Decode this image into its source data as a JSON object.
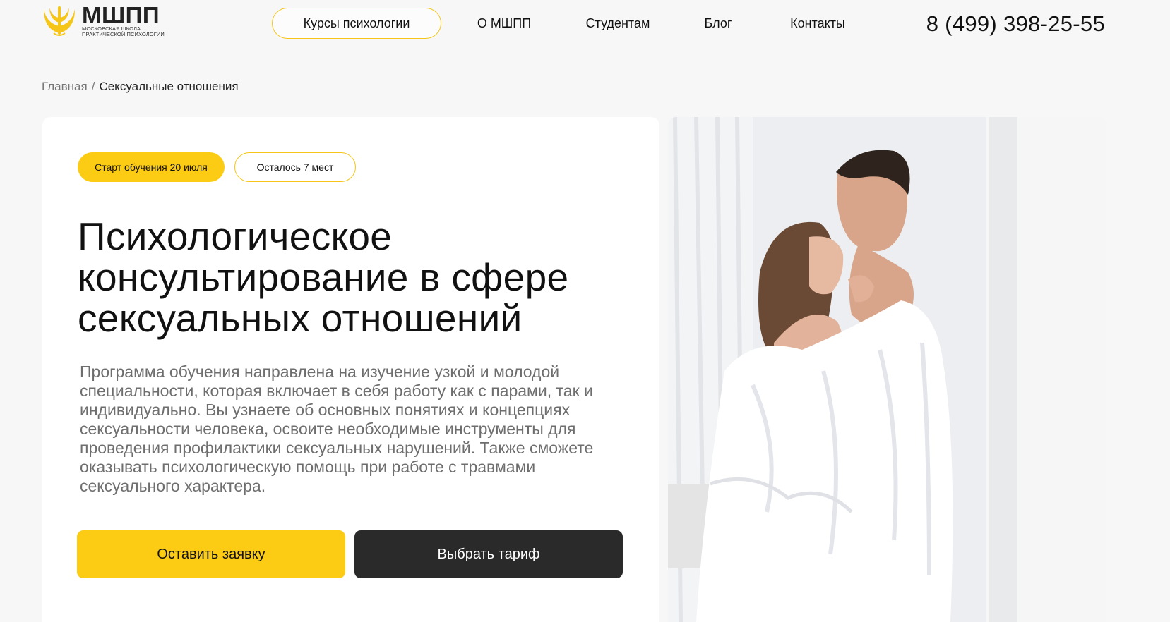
{
  "header": {
    "logo": {
      "title": "МШПП",
      "subtitle_line1": "Московская школа",
      "subtitle_line2": "практической психологии",
      "color": "#f5c518"
    },
    "nav": [
      {
        "label": "Курсы психологии"
      },
      {
        "label": "О МШПП"
      },
      {
        "label": "Студентам"
      },
      {
        "label": "Блог"
      },
      {
        "label": "Контакты"
      }
    ],
    "phone": "8 (499) 398-25-55"
  },
  "breadcrumb": {
    "home": "Главная",
    "separator": "/",
    "current": "Сексуальные отношения"
  },
  "hero": {
    "badges": {
      "start": "Старт обучения 20 июля",
      "seats": "Осталось 7 мест"
    },
    "title_line1": "Психологическое",
    "title_line2": "консультирование в сфере",
    "title_line3": "сексуальных отношений",
    "description": "Программа обучения направлена на изучение узкой и молодой специальности, которая включает в себя работу как с парами, так и индивидуально. Вы узнаете об основных понятиях и концепциях сексуальности человека, освоите необходимые инструменты для проведения профилактики сексуальных нарушений. Также сможете оказывать психологическую помощь при работе с травмами сексуального характера.",
    "primary_button": "Оставить заявку",
    "secondary_button": "Выбрать тариф",
    "image_icon": "couple-photo",
    "colors": {
      "accent": "#fccb14",
      "dark_button": "#2a2a2a",
      "text_muted": "#6e6e6e"
    }
  }
}
